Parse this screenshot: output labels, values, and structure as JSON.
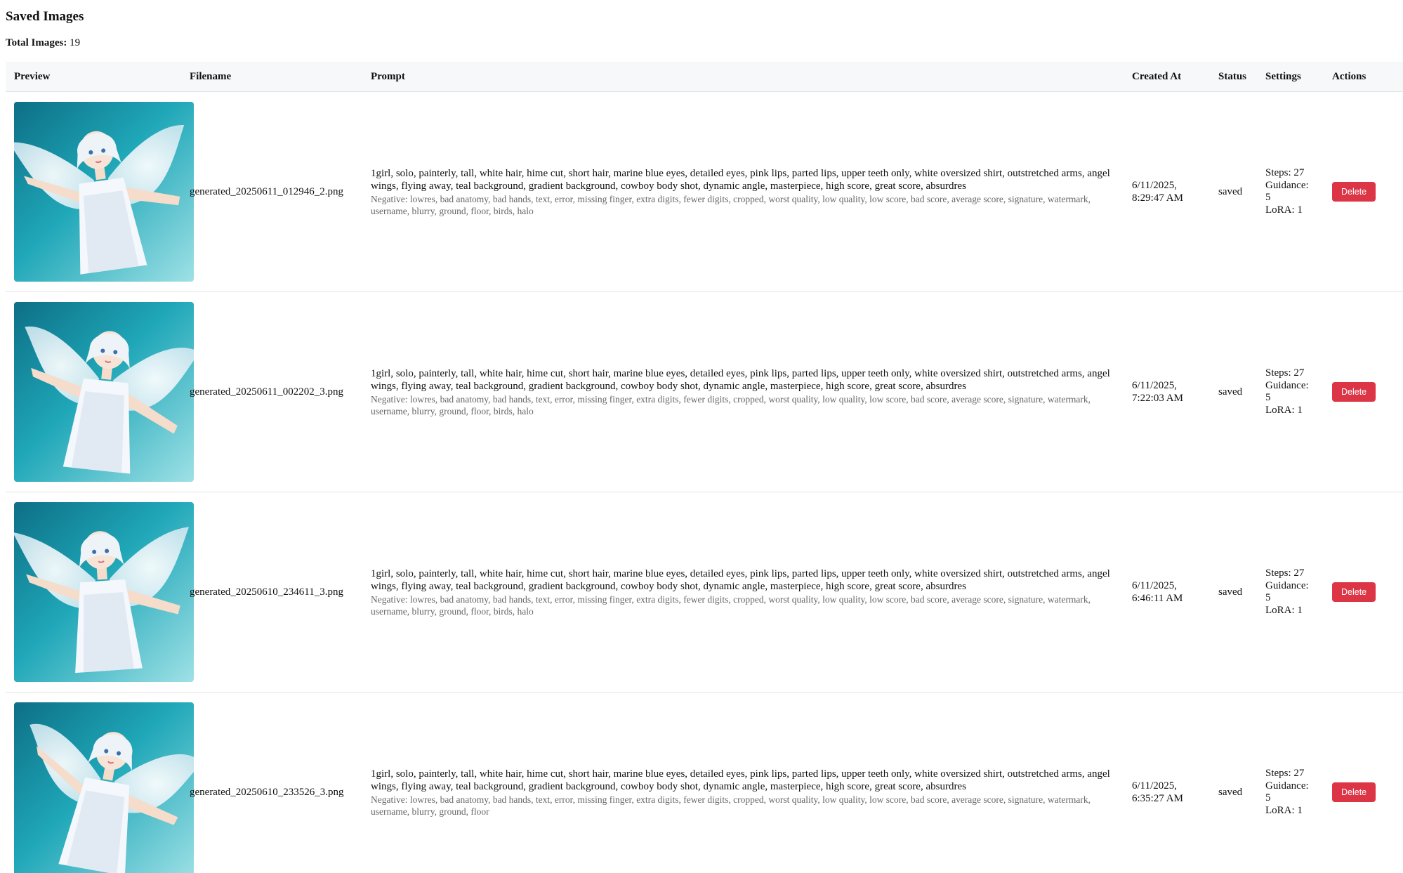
{
  "page": {
    "title": "Saved Images",
    "total_label": "Total Images:",
    "total_value": "19"
  },
  "columns": {
    "preview": "Preview",
    "filename": "Filename",
    "prompt": "Prompt",
    "created_at": "Created At",
    "status": "Status",
    "settings": "Settings",
    "actions": "Actions"
  },
  "colors": {
    "delete_button": "#dc3545",
    "header_bg": "#f7f8fa",
    "teal_background": "#1fa7b8"
  },
  "rows": [
    {
      "filename": "generated_20250611_012946_2.png",
      "prompt": "1girl, solo, painterly, tall, white hair, hime cut, short hair, marine blue eyes, detailed eyes, pink lips, parted lips, upper teeth only, white oversized shirt, outstretched arms, angel wings, flying away, teal background, gradient background, cowboy body shot, dynamic angle, masterpiece, high score, great score, absurdres",
      "negative": "Negative: lowres, bad anatomy, bad hands, text, error, missing finger, extra digits, fewer digits, cropped, worst quality, low quality, low score, bad score, average score, signature, watermark, username, blurry, ground, floor, birds, halo",
      "created_date": "6/11/2025,",
      "created_time": "8:29:47 AM",
      "status": "saved",
      "steps": "Steps: 27",
      "guidance_label": "Guidance:",
      "guidance_value": "5",
      "lora": "LoRA: 1",
      "delete_label": "Delete"
    },
    {
      "filename": "generated_20250611_002202_3.png",
      "prompt": "1girl, solo, painterly, tall, white hair, hime cut, short hair, marine blue eyes, detailed eyes, pink lips, parted lips, upper teeth only, white oversized shirt, outstretched arms, angel wings, flying away, teal background, gradient background, cowboy body shot, dynamic angle, masterpiece, high score, great score, absurdres",
      "negative": "Negative: lowres, bad anatomy, bad hands, text, error, missing finger, extra digits, fewer digits, cropped, worst quality, low quality, low score, bad score, average score, signature, watermark, username, blurry, ground, floor, birds, halo",
      "created_date": "6/11/2025,",
      "created_time": "7:22:03 AM",
      "status": "saved",
      "steps": "Steps: 27",
      "guidance_label": "Guidance:",
      "guidance_value": "5",
      "lora": "LoRA: 1",
      "delete_label": "Delete"
    },
    {
      "filename": "generated_20250610_234611_3.png",
      "prompt": "1girl, solo, painterly, tall, white hair, hime cut, short hair, marine blue eyes, detailed eyes, pink lips, parted lips, upper teeth only, white oversized shirt, outstretched arms, angel wings, flying away, teal background, gradient background, cowboy body shot, dynamic angle, masterpiece, high score, great score, absurdres",
      "negative": "Negative: lowres, bad anatomy, bad hands, text, error, missing finger, extra digits, fewer digits, cropped, worst quality, low quality, low score, bad score, average score, signature, watermark, username, blurry, ground, floor, birds, halo",
      "created_date": "6/11/2025,",
      "created_time": "6:46:11 AM",
      "status": "saved",
      "steps": "Steps: 27",
      "guidance_label": "Guidance:",
      "guidance_value": "5",
      "lora": "LoRA: 1",
      "delete_label": "Delete"
    },
    {
      "filename": "generated_20250610_233526_3.png",
      "prompt": "1girl, solo, painterly, tall, white hair, hime cut, short hair, marine blue eyes, detailed eyes, pink lips, parted lips, upper teeth only, white oversized shirt, outstretched arms, angel wings, flying away, teal background, gradient background, cowboy body shot, dynamic angle, masterpiece, high score, great score, absurdres",
      "negative": "Negative: lowres, bad anatomy, bad hands, text, error, missing finger, extra digits, fewer digits, cropped, worst quality, low quality, low score, bad score, average score, signature, watermark, username, blurry, ground, floor",
      "created_date": "6/11/2025,",
      "created_time": "6:35:27 AM",
      "status": "saved",
      "steps": "Steps: 27",
      "guidance_label": "Guidance:",
      "guidance_value": "5",
      "lora": "LoRA: 1",
      "delete_label": "Delete"
    }
  ]
}
